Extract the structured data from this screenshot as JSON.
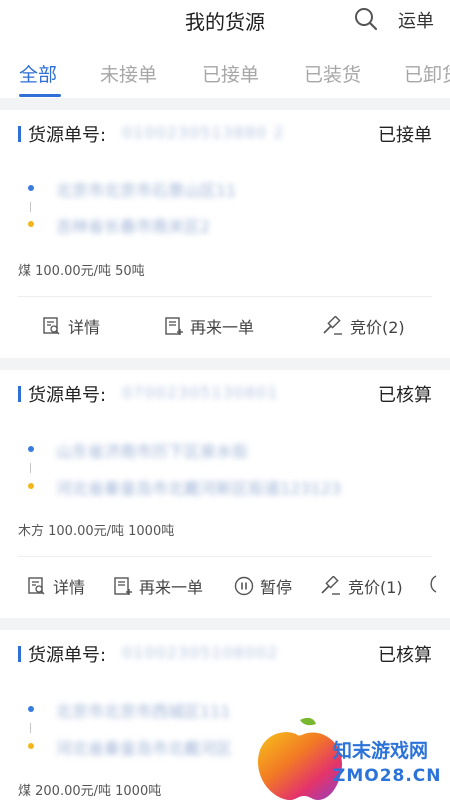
{
  "header": {
    "title": "我的货源",
    "right_link": "运单"
  },
  "tabs": [
    "全部",
    "未接单",
    "已接单",
    "已装货",
    "已卸货"
  ],
  "cards": [
    {
      "label": "货源单号:",
      "number": "0100230513880 2",
      "status": "已接单",
      "from": "北京市北京市石景山区11",
      "to": "吉林省长春市南关区2",
      "cargo": "煤  100.00元/吨  50吨",
      "actions": [
        "详情",
        "再来一单",
        "竞价(2)"
      ]
    },
    {
      "label": "货源单号:",
      "number": "07002305130801",
      "status": "已核算",
      "from": "山东省济南市历下区泉水街",
      "to": "河北省秦皇岛市北戴河新区街道123123",
      "cargo": "木方  100.00元/吨  1000吨",
      "actions": [
        "详情",
        "再来一单",
        "暂停",
        "竞价(1)"
      ]
    },
    {
      "label": "货源单号:",
      "number": "01002305108002",
      "status": "已核算",
      "from": "北京市北京市西城区111",
      "to": "河北省秦皇岛市北戴河区",
      "cargo": "煤  200.00元/吨  1000吨"
    }
  ],
  "watermark": {
    "line1": "知末游戏网",
    "line2": "ZMO28.CN"
  },
  "colors": {
    "accent": "#2f6fd6",
    "dot_blue": "#3a7be0",
    "dot_yellow": "#f2b51c"
  }
}
